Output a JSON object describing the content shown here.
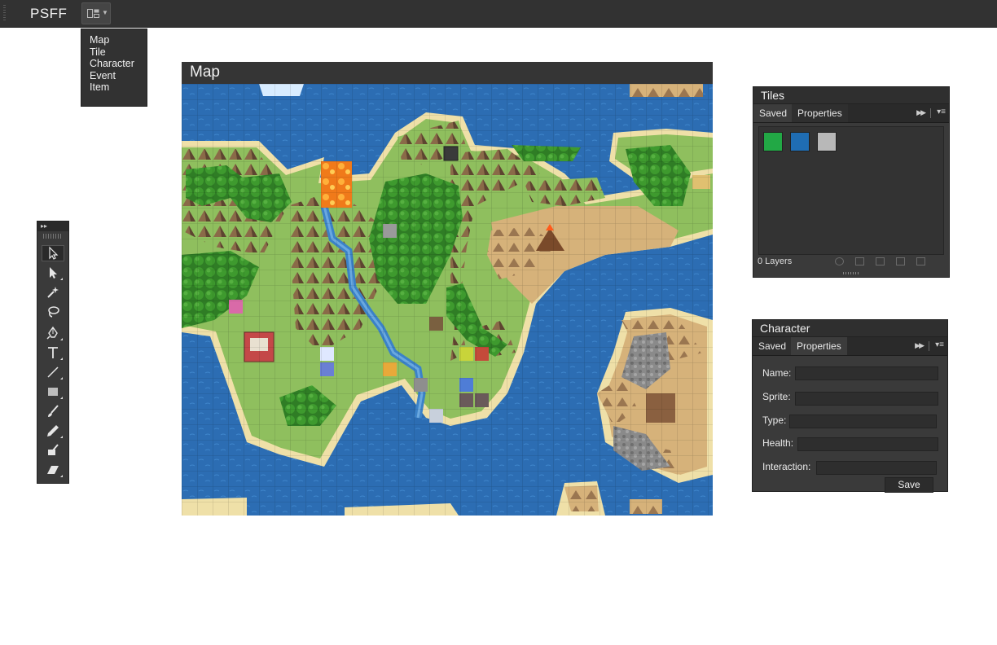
{
  "app": {
    "title": "PSFF"
  },
  "workspace_menu": {
    "icon": "workspace-grid-icon",
    "items": [
      "Map",
      "Tile",
      "Character",
      "Event",
      "Item"
    ]
  },
  "map_panel": {
    "title": "Map"
  },
  "tools": [
    "selection-arrow-icon",
    "direct-select-icon",
    "magic-wand-icon",
    "lasso-icon",
    "pen-icon",
    "type-icon",
    "line-icon",
    "rectangle-icon",
    "brush-icon",
    "pencil-icon",
    "blob-brush-icon",
    "eraser-icon"
  ],
  "tiles_panel": {
    "title": "Tiles",
    "tabs": [
      "Saved",
      "Properties"
    ],
    "swatches": [
      "#22a845",
      "#1f6db3",
      "#b8b8b8"
    ],
    "footer": "0 Layers"
  },
  "character_panel": {
    "title": "Character",
    "tabs": [
      "Saved",
      "Properties"
    ],
    "fields": {
      "name": "Name:",
      "sprite": "Sprite:",
      "type": "Type:",
      "health": "Health:",
      "interaction": "Interaction:"
    },
    "save_label": "Save"
  }
}
